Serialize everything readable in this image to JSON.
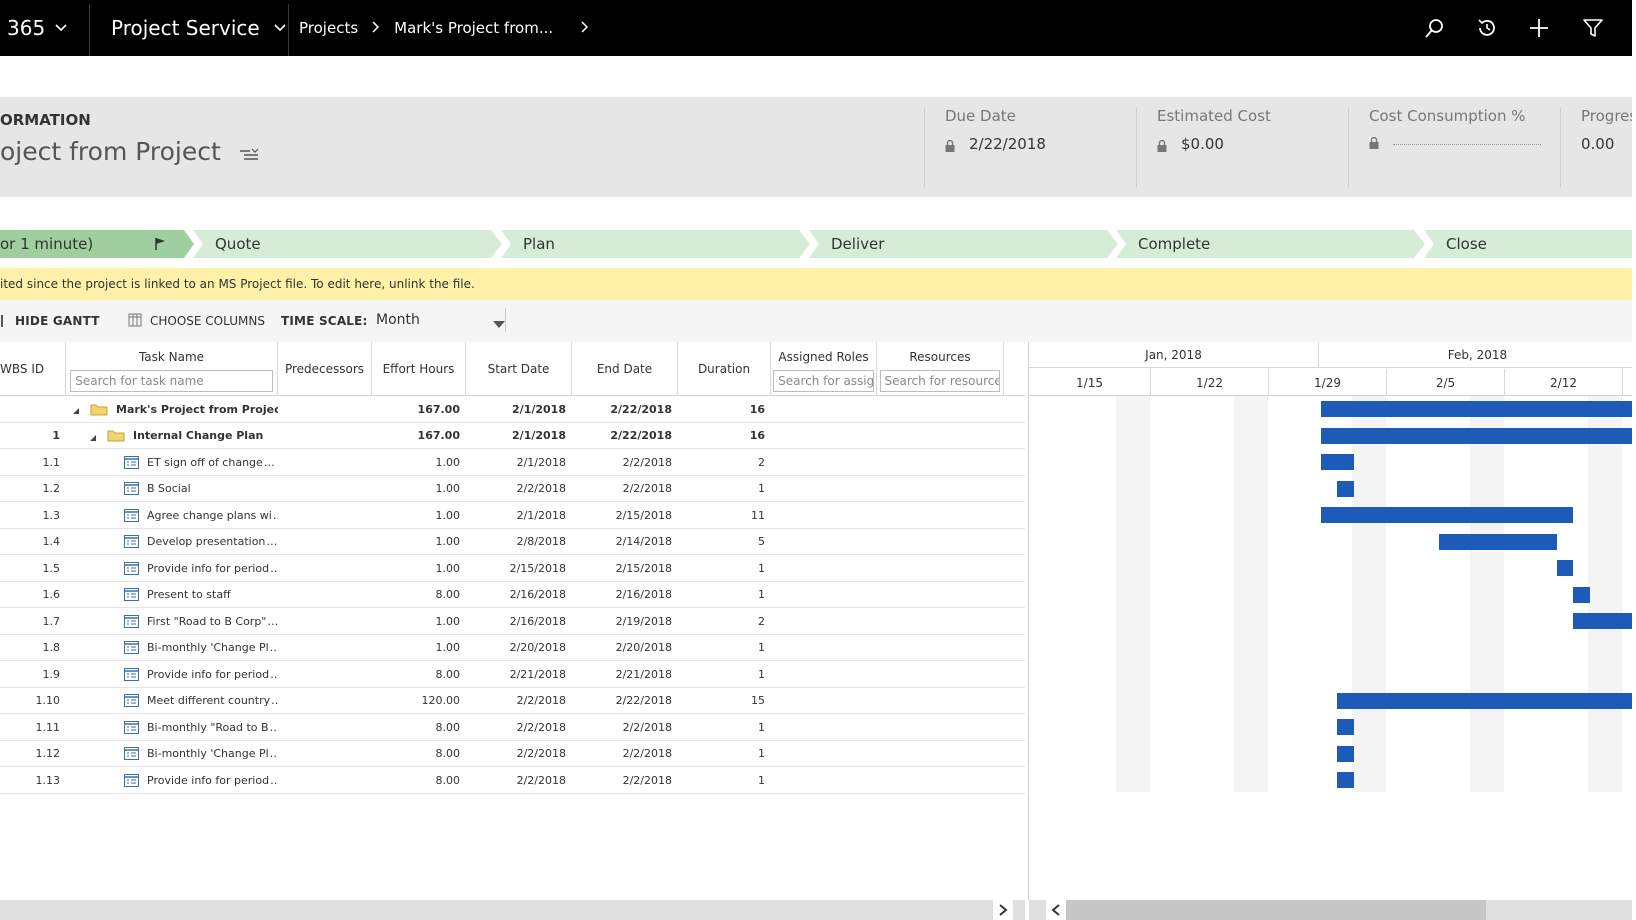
{
  "nav": {
    "app_partial": "365",
    "module": "Project Service",
    "breadcrumbs": [
      "Projects",
      "Mark's Project from..."
    ],
    "icons": [
      "search-icon",
      "history-icon",
      "plus-icon",
      "filter-icon"
    ]
  },
  "header": {
    "entity_label": "ORMATION",
    "entity_title": "oject from Project",
    "fields": [
      {
        "label": "Due Date",
        "value": "2/22/2018",
        "locked": true
      },
      {
        "label": "Estimated Cost",
        "value": "$0.00",
        "locked": true
      },
      {
        "label": "Cost Consumption %",
        "value": "",
        "locked": true
      },
      {
        "label": "Progress",
        "value": "0.00",
        "locked": false
      }
    ]
  },
  "stages": [
    {
      "label": "or 1 minute)",
      "active": true
    },
    {
      "label": "Quote",
      "active": false
    },
    {
      "label": "Plan",
      "active": false
    },
    {
      "label": "Deliver",
      "active": false
    },
    {
      "label": "Complete",
      "active": false
    },
    {
      "label": "Close",
      "active": false
    }
  ],
  "warning": "ited since the project is linked to an MS Project file. To edit here, unlink the file.",
  "toolbar": {
    "hide_gantt": "HIDE GANTT",
    "choose_columns": "CHOOSE COLUMNS",
    "time_scale_label": "TIME SCALE:",
    "time_scale_value": "Month"
  },
  "columns": {
    "wbs": "WBS ID",
    "task_name": "Task Name",
    "task_search": "Search for task name",
    "predecessors": "Predecessors",
    "effort": "Effort Hours",
    "start": "Start Date",
    "end": "End Date",
    "duration": "Duration",
    "roles": "Assigned Roles",
    "roles_search": "Search for assigned",
    "resources": "Resources",
    "resources_search": "Search for resources"
  },
  "tasks": [
    {
      "wbs": "",
      "name": "Mark's Project from Project",
      "effort": "167.00",
      "start": "2/1/2018",
      "end": "2/22/2018",
      "duration": "16",
      "level": 0,
      "summary": true,
      "ellipsis": false
    },
    {
      "wbs": "1",
      "name": "Internal Change Plan",
      "effort": "167.00",
      "start": "2/1/2018",
      "end": "2/22/2018",
      "duration": "16",
      "level": 1,
      "summary": true,
      "ellipsis": false
    },
    {
      "wbs": "1.1",
      "name": "ET sign off of change",
      "effort": "1.00",
      "start": "2/1/2018",
      "end": "2/2/2018",
      "duration": "2",
      "level": 2,
      "summary": false,
      "ellipsis": true
    },
    {
      "wbs": "1.2",
      "name": "B Social",
      "effort": "1.00",
      "start": "2/2/2018",
      "end": "2/2/2018",
      "duration": "1",
      "level": 2,
      "summary": false,
      "ellipsis": false
    },
    {
      "wbs": "1.3",
      "name": "Agree change plans wi",
      "effort": "1.00",
      "start": "2/1/2018",
      "end": "2/15/2018",
      "duration": "11",
      "level": 2,
      "summary": false,
      "ellipsis": true
    },
    {
      "wbs": "1.4",
      "name": "Develop presentation",
      "effort": "1.00",
      "start": "2/8/2018",
      "end": "2/14/2018",
      "duration": "5",
      "level": 2,
      "summary": false,
      "ellipsis": true
    },
    {
      "wbs": "1.5",
      "name": "Provide info for period",
      "effort": "1.00",
      "start": "2/15/2018",
      "end": "2/15/2018",
      "duration": "1",
      "level": 2,
      "summary": false,
      "ellipsis": true
    },
    {
      "wbs": "1.6",
      "name": "Present to staff",
      "effort": "8.00",
      "start": "2/16/2018",
      "end": "2/16/2018",
      "duration": "1",
      "level": 2,
      "summary": false,
      "ellipsis": false
    },
    {
      "wbs": "1.7",
      "name": "First \"Road to B Corp\"",
      "effort": "1.00",
      "start": "2/16/2018",
      "end": "2/19/2018",
      "duration": "2",
      "level": 2,
      "summary": false,
      "ellipsis": true
    },
    {
      "wbs": "1.8",
      "name": "Bi-monthly 'Change Pl",
      "effort": "1.00",
      "start": "2/20/2018",
      "end": "2/20/2018",
      "duration": "1",
      "level": 2,
      "summary": false,
      "ellipsis": true
    },
    {
      "wbs": "1.9",
      "name": "Provide info for period",
      "effort": "8.00",
      "start": "2/21/2018",
      "end": "2/21/2018",
      "duration": "1",
      "level": 2,
      "summary": false,
      "ellipsis": true
    },
    {
      "wbs": "1.10",
      "name": "Meet different country",
      "effort": "120.00",
      "start": "2/2/2018",
      "end": "2/22/2018",
      "duration": "15",
      "level": 2,
      "summary": false,
      "ellipsis": true
    },
    {
      "wbs": "1.11",
      "name": "Bi-monthly \"Road to B",
      "effort": "8.00",
      "start": "2/2/2018",
      "end": "2/2/2018",
      "duration": "1",
      "level": 2,
      "summary": false,
      "ellipsis": true
    },
    {
      "wbs": "1.12",
      "name": "Bi-monthly 'Change Pl",
      "effort": "8.00",
      "start": "2/2/2018",
      "end": "2/2/2018",
      "duration": "1",
      "level": 2,
      "summary": false,
      "ellipsis": true
    },
    {
      "wbs": "1.13",
      "name": "Provide info for period",
      "effort": "8.00",
      "start": "2/2/2018",
      "end": "2/2/2018",
      "duration": "1",
      "level": 2,
      "summary": false,
      "ellipsis": true
    }
  ],
  "gantt": {
    "months": [
      "Jan, 2018",
      "Feb, 2018"
    ],
    "weeks": [
      "1/15",
      "1/22",
      "1/29",
      "2/5",
      "2/12"
    ],
    "bar_color": "#1e5bb8"
  },
  "colors": {
    "nav_bg": "#000000",
    "stage_active": "#9fcf9f",
    "stage_inactive": "#d6ecd6",
    "warning_bg": "#fff1a8"
  }
}
